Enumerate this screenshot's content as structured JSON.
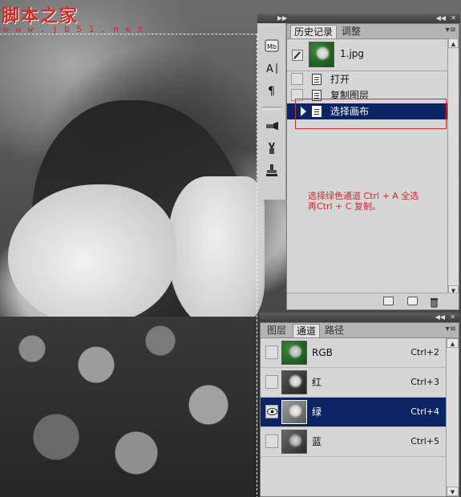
{
  "watermark": {
    "site_name": "脚本之家",
    "url": "w w w . j b 5 1 . n e t"
  },
  "history_panel": {
    "tabs": [
      "历史记录",
      "调整"
    ],
    "snapshot": {
      "name": "1.jpg"
    },
    "items": [
      {
        "label": "打开",
        "selected": false
      },
      {
        "label": "复制图层",
        "selected": false
      },
      {
        "label": "选择画布",
        "selected": true
      }
    ],
    "annotation": "选择绿色通道 Ctrl + A 全选\n再Ctrl + C 复制。",
    "annotation_color": "#d42a2a",
    "highlight_box_color": "#d42a2a"
  },
  "channels_panel": {
    "tabs": [
      "图层",
      "通道",
      "路径"
    ],
    "active_tab": "通道",
    "rows": [
      {
        "name": "RGB",
        "shortcut": "Ctrl+2",
        "visible": false,
        "selected": false
      },
      {
        "name": "红",
        "shortcut": "Ctrl+3",
        "visible": false,
        "selected": false
      },
      {
        "name": "绿",
        "shortcut": "Ctrl+4",
        "visible": true,
        "selected": true
      },
      {
        "name": "蓝",
        "shortcut": "Ctrl+5",
        "visible": false,
        "selected": false
      }
    ]
  },
  "colors": {
    "selection_blue": "#0b2463",
    "panel_bg": "#d6d6d6"
  }
}
